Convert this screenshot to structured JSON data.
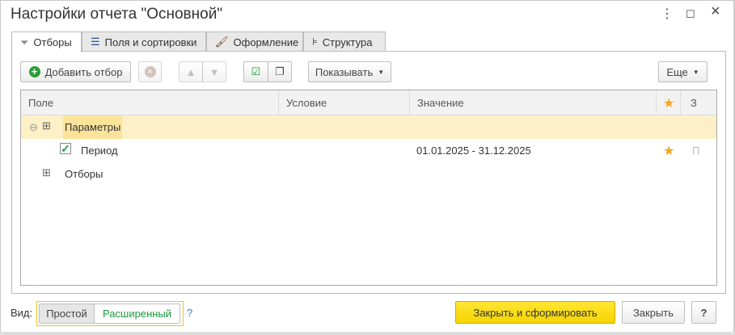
{
  "window": {
    "title": "Настройки отчета \"Основной\"",
    "menu_icon": "⋮",
    "maximize_icon": "☐",
    "close_icon": "×"
  },
  "tabs": [
    {
      "label": "Отборы",
      "icon": "filter-icon"
    },
    {
      "label": "Поля и сортировки",
      "icon": "fields-sort-icon"
    },
    {
      "label": "Оформление",
      "icon": "brush-icon"
    },
    {
      "label": "Структура",
      "icon": "structure-icon"
    }
  ],
  "toolbar": {
    "add_filter": "Добавить отбор",
    "show": "Показывать",
    "more": "Еще"
  },
  "table": {
    "headers": {
      "field": "Поле",
      "condition": "Условие",
      "value": "Значение",
      "star": "★",
      "z": "З"
    },
    "rows": [
      {
        "field": "Параметры",
        "expander": "⊖"
      },
      {
        "field": "Период",
        "value": "01.01.2025 - 31.12.2025",
        "star": "★",
        "z": "П",
        "checked": true
      },
      {
        "field": "Отборы"
      }
    ]
  },
  "footer": {
    "view_label": "Вид:",
    "simple": "Простой",
    "extended": "Расширенный",
    "help_link": "?",
    "generate": "Закрыть и сформировать",
    "close": "Закрыть",
    "help": "?"
  },
  "colors": {
    "highlight": "#fdf0c6",
    "accent_yellow": "#f5d400",
    "star": "#f6a623",
    "green": "#1a9a3a"
  }
}
